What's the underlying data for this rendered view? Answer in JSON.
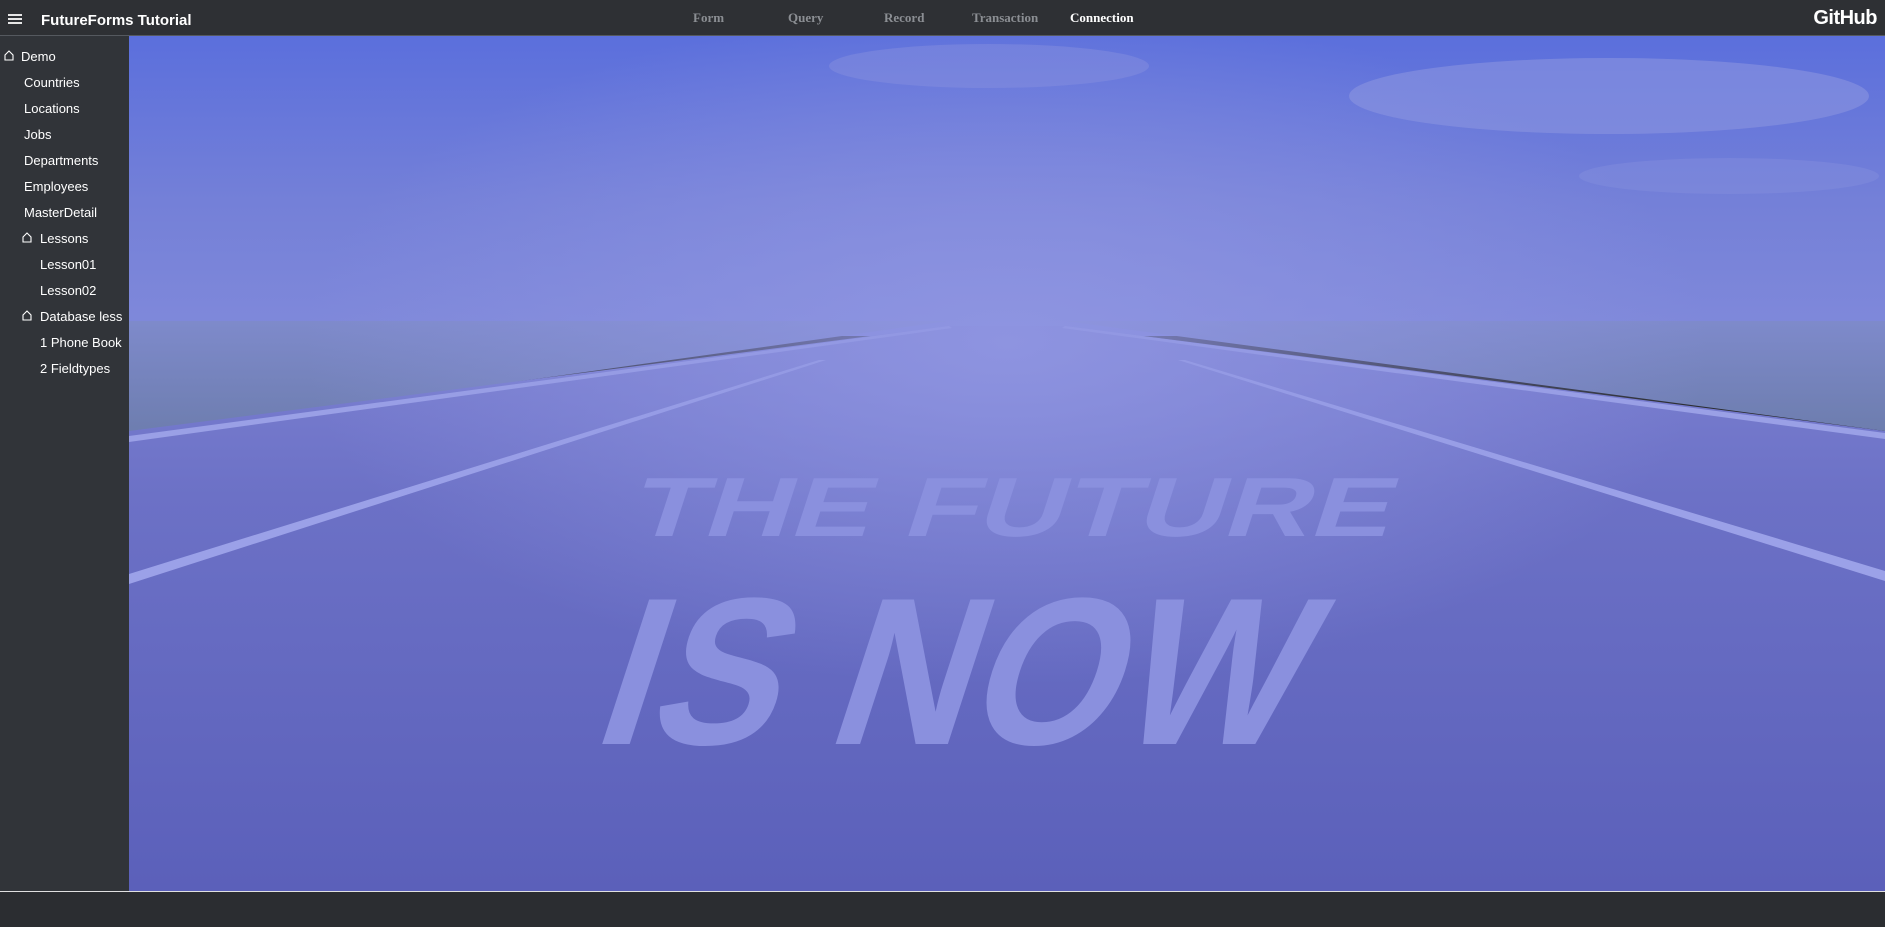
{
  "header": {
    "app_title": "FutureForms Tutorial",
    "nav": [
      {
        "label": "Form"
      },
      {
        "label": "Query"
      },
      {
        "label": "Record"
      },
      {
        "label": "Transaction"
      },
      {
        "label": "Connection",
        "active": true
      }
    ],
    "github_label": "GitHub"
  },
  "sidebar": {
    "items": [
      {
        "label": "Demo",
        "folder": true
      },
      {
        "label": "Countries"
      },
      {
        "label": "Locations"
      },
      {
        "label": "Jobs"
      },
      {
        "label": "Departments"
      },
      {
        "label": "Employees"
      },
      {
        "label": "MasterDetail"
      },
      {
        "label": "Lessons",
        "folder": true
      },
      {
        "label": "Lesson01"
      },
      {
        "label": "Lesson02"
      },
      {
        "label": "Database less",
        "folder": true
      },
      {
        "label": "1 Phone Book"
      },
      {
        "label": "2 Fieldtypes"
      }
    ]
  },
  "hero": {
    "line1": "THE FUTURE",
    "line2": "IS NOW"
  },
  "colors": {
    "topbar": "#2e3034",
    "sidebar": "#313439",
    "overlay": "#6b72d6",
    "active_nav": "#ffffff",
    "inactive_nav": "#8b8e93"
  }
}
